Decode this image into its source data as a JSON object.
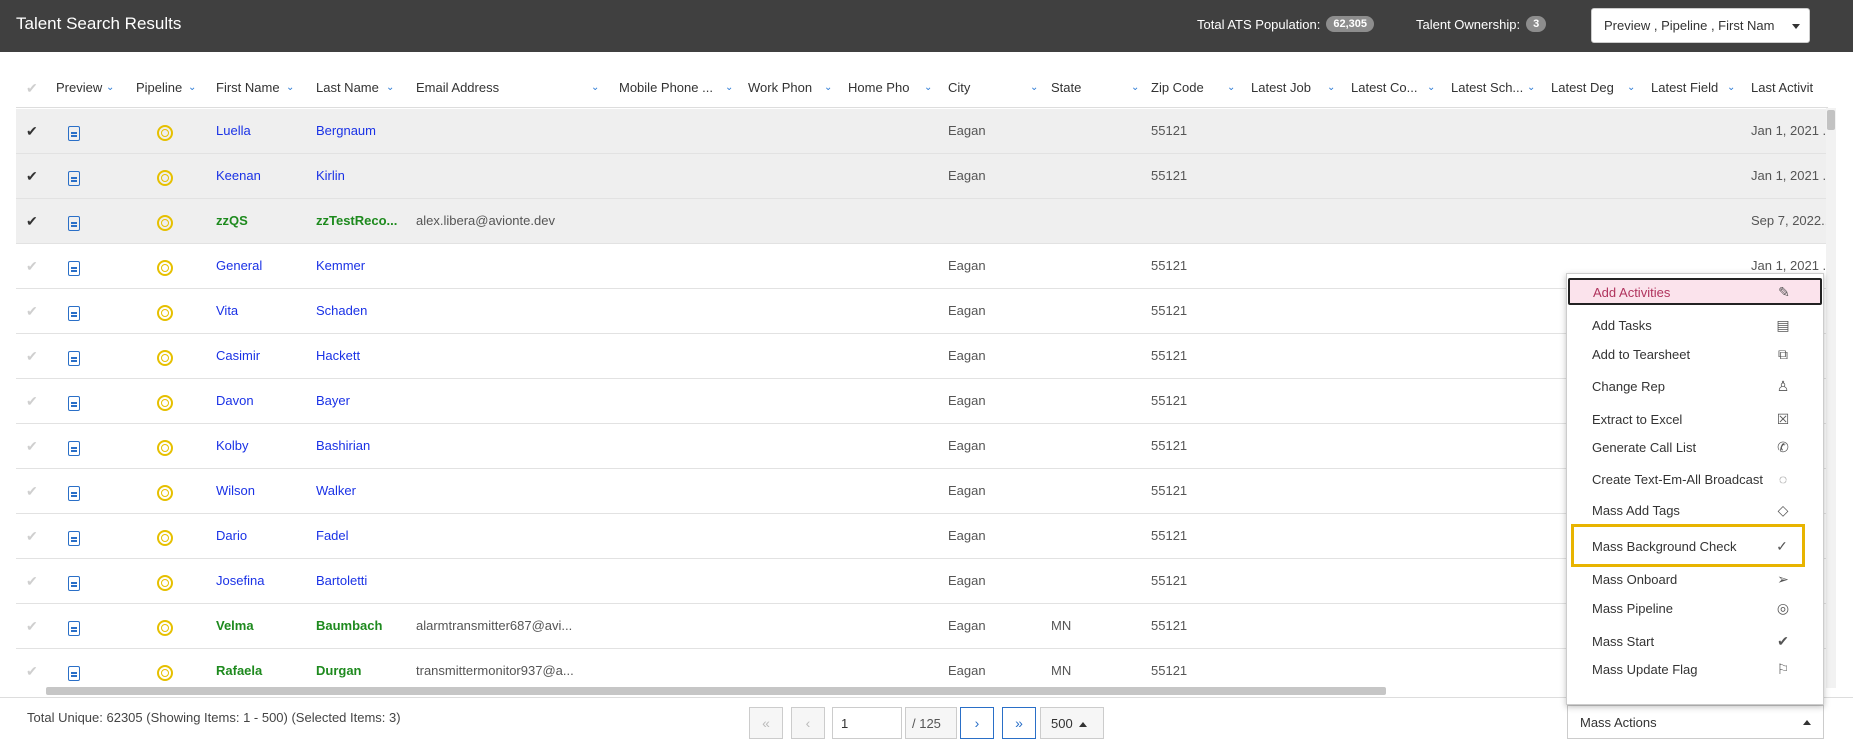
{
  "header": {
    "title": "Talent Search Results",
    "population_label": "Total ATS Population:",
    "population_value": "62,305",
    "ownership_label": "Talent Ownership:",
    "ownership_value": "3",
    "preview_dropdown": "Preview , Pipeline , First Nam"
  },
  "columns": {
    "preview": "Preview",
    "pipeline": "Pipeline",
    "first_name": "First Name",
    "last_name": "Last Name",
    "email": "Email Address",
    "mobile": "Mobile Phone ...",
    "work": "Work Phon",
    "home": "Home Pho",
    "city": "City",
    "state": "State",
    "zip": "Zip Code",
    "latest_job": "Latest Job",
    "latest_co": "Latest Co...",
    "latest_sch": "Latest Sch...",
    "latest_deg": "Latest Deg",
    "latest_field": "Latest Field",
    "last_activity": "Last Activit"
  },
  "rows": [
    {
      "selected": true,
      "first": "Luella",
      "last": "Bergnaum",
      "color": "blue",
      "email": "",
      "city": "Eagan",
      "state": "",
      "zip": "55121",
      "activity": "Jan 1, 2021 ..."
    },
    {
      "selected": true,
      "first": "Keenan",
      "last": "Kirlin",
      "color": "blue",
      "email": "",
      "city": "Eagan",
      "state": "",
      "zip": "55121",
      "activity": "Jan 1, 2021 ..."
    },
    {
      "selected": true,
      "first": "zzQS",
      "last": "zzTestReco...",
      "color": "green",
      "email": "alex.libera@avionte.dev",
      "city": "",
      "state": "",
      "zip": "",
      "activity": "Sep 7, 2022..."
    },
    {
      "selected": false,
      "first": "General",
      "last": "Kemmer",
      "color": "blue",
      "email": "",
      "city": "Eagan",
      "state": "",
      "zip": "55121",
      "activity": "Jan 1, 2021 ..."
    },
    {
      "selected": false,
      "first": "Vita",
      "last": "Schaden",
      "color": "blue",
      "email": "",
      "city": "Eagan",
      "state": "",
      "zip": "55121",
      "activity": ""
    },
    {
      "selected": false,
      "first": "Casimir",
      "last": "Hackett",
      "color": "blue",
      "email": "",
      "city": "Eagan",
      "state": "",
      "zip": "55121",
      "activity": ""
    },
    {
      "selected": false,
      "first": "Davon",
      "last": "Bayer",
      "color": "blue",
      "email": "",
      "city": "Eagan",
      "state": "",
      "zip": "55121",
      "activity": ""
    },
    {
      "selected": false,
      "first": "Kolby",
      "last": "Bashirian",
      "color": "blue",
      "email": "",
      "city": "Eagan",
      "state": "",
      "zip": "55121",
      "activity": ""
    },
    {
      "selected": false,
      "first": "Wilson",
      "last": "Walker",
      "color": "blue",
      "email": "",
      "city": "Eagan",
      "state": "",
      "zip": "55121",
      "activity": ""
    },
    {
      "selected": false,
      "first": "Dario",
      "last": "Fadel",
      "color": "blue",
      "email": "",
      "city": "Eagan",
      "state": "",
      "zip": "55121",
      "activity": ""
    },
    {
      "selected": false,
      "first": "Josefina",
      "last": "Bartoletti",
      "color": "blue",
      "email": "",
      "city": "Eagan",
      "state": "",
      "zip": "55121",
      "activity": ""
    },
    {
      "selected": false,
      "first": "Velma",
      "last": "Baumbach",
      "color": "green",
      "email": "alarmtransmitter687@avi...",
      "city": "Eagan",
      "state": "MN",
      "zip": "55121",
      "activity": ""
    },
    {
      "selected": false,
      "first": "Rafaela",
      "last": "Durgan",
      "color": "green",
      "email": "transmittermonitor937@a...",
      "city": "Eagan",
      "state": "MN",
      "zip": "55121",
      "activity": ""
    }
  ],
  "menu": {
    "items": [
      {
        "label": "Add Activities",
        "icon": "pencil-icon",
        "glyph": "✎"
      },
      {
        "label": "Add Tasks",
        "icon": "clipboard-icon",
        "glyph": "▤"
      },
      {
        "label": "Add to Tearsheet",
        "icon": "copy-icon",
        "glyph": "⧉"
      },
      {
        "label": "Change Rep",
        "icon": "person-icon",
        "glyph": "♙"
      },
      {
        "label": "Extract to Excel",
        "icon": "excel-icon",
        "glyph": "☒"
      },
      {
        "label": "Generate Call List",
        "icon": "phone-icon",
        "glyph": "✆"
      },
      {
        "label": "Create Text-Em-All Broadcast",
        "icon": "chat-icon",
        "glyph": "◌"
      },
      {
        "label": "Mass Add Tags",
        "icon": "tag-icon",
        "glyph": "◇"
      },
      {
        "label": "Mass Background Check",
        "icon": "check-circle-icon",
        "glyph": "✓"
      },
      {
        "label": "Mass Onboard",
        "icon": "send-icon",
        "glyph": "➢"
      },
      {
        "label": "Mass Pipeline",
        "icon": "target-icon",
        "glyph": "◎"
      },
      {
        "label": "Mass Start",
        "icon": "checkmark-icon",
        "glyph": "✔"
      },
      {
        "label": "Mass Update Flag",
        "icon": "flag-icon",
        "glyph": "⚐"
      }
    ]
  },
  "footer": {
    "summary": "Total Unique: 62305 (Showing Items: 1 - 500) (Selected Items: 3)",
    "page_value": "1",
    "page_total": "/ 125",
    "page_size": "500",
    "mass_actions": "Mass Actions",
    "first_glyph": "«",
    "prev_glyph": "‹",
    "next_glyph": "›",
    "last_glyph": "»"
  },
  "colors": {
    "header_bg": "#404040",
    "link_blue": "#1a32e6",
    "link_green": "#1e8a1e",
    "hover_bg": "#fbe3ec",
    "highlight_border": "#e8b400"
  }
}
